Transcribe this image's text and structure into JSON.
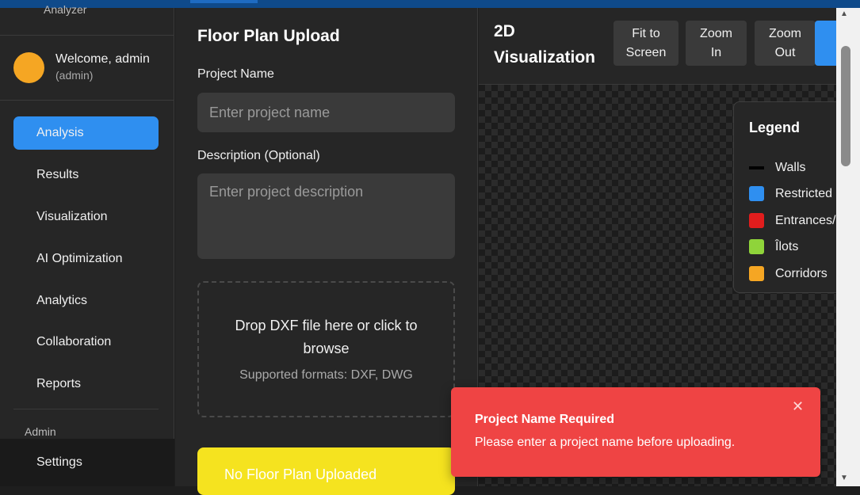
{
  "sidebar": {
    "brand": "Analyzer",
    "user": {
      "welcome": "Welcome, admin",
      "role": "(admin)",
      "avatar_color": "#f5a623"
    },
    "items": [
      {
        "label": "Analysis",
        "active": true
      },
      {
        "label": "Results"
      },
      {
        "label": "Visualization"
      },
      {
        "label": "AI Optimization"
      },
      {
        "label": "Analytics"
      },
      {
        "label": "Collaboration"
      },
      {
        "label": "Reports"
      }
    ],
    "admin_label": "Admin",
    "settings": "Settings"
  },
  "upload": {
    "title": "Floor Plan Upload",
    "project_name_label": "Project Name",
    "project_name_placeholder": "Enter project name",
    "description_label": "Description (Optional)",
    "description_placeholder": "Enter project description",
    "drop_main": "Drop DXF file here or click to browse",
    "drop_sub": "Supported formats: DXF, DWG",
    "warning": "No Floor Plan Uploaded"
  },
  "viz": {
    "title": "2D Visualization",
    "buttons": {
      "fit": "Fit to Screen",
      "zoom_in": "Zoom In",
      "zoom_out": "Zoom Out"
    },
    "legend": {
      "title": "Legend",
      "items": [
        {
          "label": "Walls",
          "color": "#000000"
        },
        {
          "label": "Restricted",
          "color": "#2f8ff0"
        },
        {
          "label": "Entrances/",
          "color": "#e11d1d"
        },
        {
          "label": "Îlots",
          "color": "#8fd43a"
        },
        {
          "label": "Corridors",
          "color": "#f5a623"
        }
      ]
    }
  },
  "toast": {
    "title": "Project Name Required",
    "message": "Please enter a project name before uploading.",
    "close": "✕",
    "color": "#ef4444"
  },
  "colors": {
    "accent": "#2f8ff0",
    "warning": "#f5e31f"
  }
}
